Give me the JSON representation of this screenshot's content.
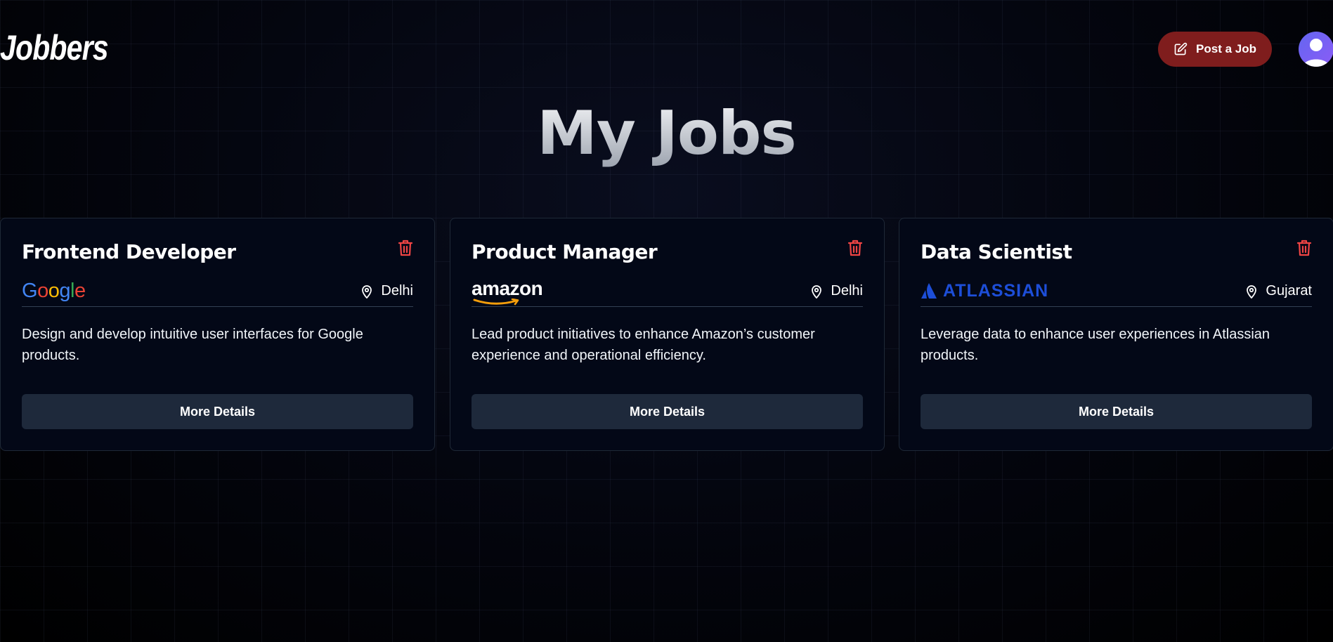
{
  "header": {
    "logo": "Jobbers",
    "post_button_label": "Post a Job"
  },
  "page": {
    "title": "My Jobs"
  },
  "colors": {
    "post_button": "#7f1d1d",
    "delete_icon": "#ef4444",
    "card_background": "#030817",
    "details_button": "#1e293b",
    "atlassian_blue": "#1d4ed8"
  },
  "jobs": [
    {
      "title": "Frontend Developer",
      "company": "Google",
      "location": "Delhi",
      "description": "Design and develop intuitive user interfaces for Google products.",
      "button_label": "More Details"
    },
    {
      "title": "Product Manager",
      "company": "amazon",
      "location": "Delhi",
      "description": "Lead product initiatives to enhance Amazon’s customer experience and operational efficiency.",
      "button_label": "More Details"
    },
    {
      "title": "Data Scientist",
      "company": "ATLASSIAN",
      "location": "Gujarat",
      "description": "Leverage data to enhance user experiences in Atlassian products.",
      "button_label": "More Details"
    }
  ],
  "icons": {
    "post": "edit-icon",
    "delete": "trash-icon",
    "location": "map-pin-icon",
    "avatar": "user-avatar-icon"
  }
}
